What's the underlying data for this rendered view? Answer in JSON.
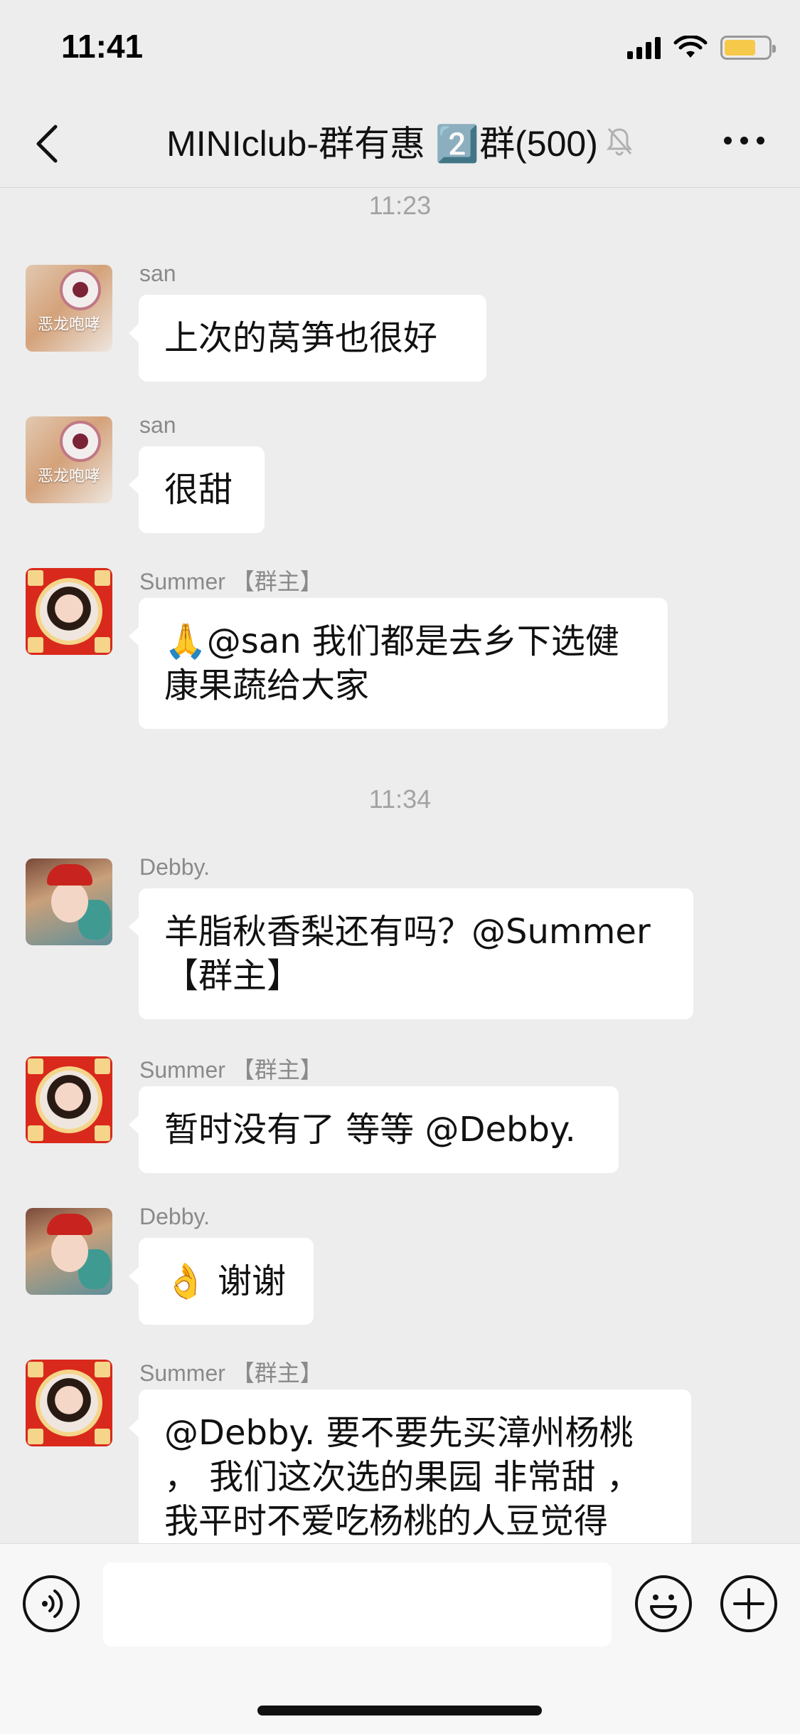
{
  "status_bar": {
    "time": "11:41",
    "battery_level_fraction": 0.72
  },
  "header": {
    "title": "MINIclub-群有惠 2️⃣群(500)",
    "icons": [
      "back-icon",
      "mute-bell-icon",
      "more-icon"
    ]
  },
  "chat": {
    "timestamps": [
      "11:23",
      "11:34"
    ],
    "messages": [
      {
        "sender": "san",
        "avatar": "cat-avatar",
        "avatar_text": "恶龙咆哮",
        "text": "上次的莴笋也很好"
      },
      {
        "sender": "san",
        "avatar": "cat-avatar",
        "avatar_text": "恶龙咆哮",
        "text": "很甜"
      },
      {
        "sender": "Summer 【群主】",
        "avatar": "summer-avatar",
        "text": "🙏@san 我们都是去乡下选健康果蔬给大家"
      },
      {
        "sender": "Debby.",
        "avatar": "debby-avatar",
        "text": "羊脂秋香梨还有吗？@Summer 【群主】"
      },
      {
        "sender": "Summer 【群主】",
        "avatar": "summer-avatar",
        "text": "暂时没有了 等等 @Debby."
      },
      {
        "sender": "Debby.",
        "avatar": "debby-avatar",
        "text": "👌 谢谢"
      },
      {
        "sender": "Summer 【群主】",
        "avatar": "summer-avatar",
        "text": "@Debby. 要不要先买漳州杨桃 ， 我们这次选的果园 非常甜 ，我平时不爱吃杨桃的人豆觉得"
      }
    ]
  },
  "input_bar": {
    "value": "",
    "icons": [
      "voice-icon",
      "emoji-icon",
      "plus-icon"
    ]
  }
}
